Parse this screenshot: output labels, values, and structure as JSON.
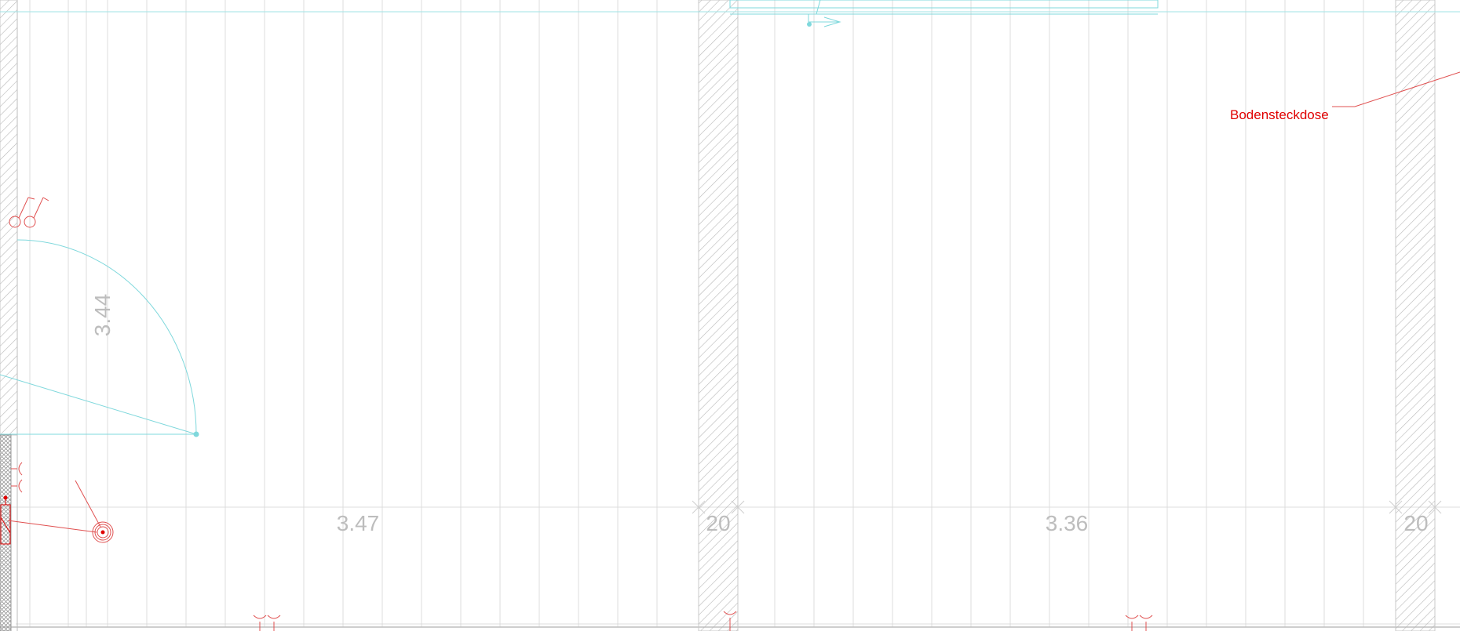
{
  "labels": {
    "outlet": "Bodensteckdose"
  },
  "dimensions": {
    "room_height": "3.44",
    "room_1_width": "3.47",
    "wall_1": "20",
    "room_2_width": "3.36",
    "wall_2": "20"
  },
  "colors": {
    "grid": "#d9d9d9",
    "hatch": "#b8b8b8",
    "cyan": "#7fd8dc",
    "red": "#e00000",
    "dimension": "#bdbdbd"
  }
}
